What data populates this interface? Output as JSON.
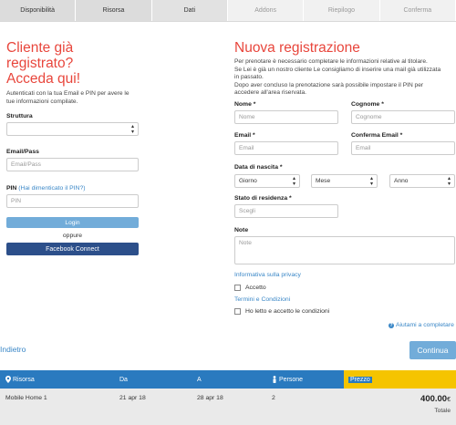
{
  "steps": [
    "Disponibilità",
    "Risorsa",
    "Dati",
    "Addons",
    "Riepilogo",
    "Conferma"
  ],
  "login": {
    "title_l1": "Cliente già",
    "title_l2": "registrato?",
    "title_l3": "Acceda qui!",
    "intro_l1": "Autenticati con la tua Email e PIN per avere le",
    "intro_l2": "tue informazioni compilate.",
    "structure_label": "Struttura",
    "structure_value": "",
    "email_label": "Email/Pass",
    "email_placeholder": "Email/Pass",
    "pin_label": "PIN",
    "pin_forgot": "(Hai dimenticato il PIN?)",
    "pin_placeholder": "PIN",
    "login_button": "Login",
    "or_text": "oppure",
    "facebook_button": "Facebook Connect"
  },
  "register": {
    "title": "Nuova registrazione",
    "info_l1": "Per prenotare è necessario completare le informazioni relative al titolare.",
    "info_l2": "Se Lei è già un nostro cliente Le consigliamo di inserire una mail già utilizzata",
    "info_l3": "in passato.",
    "info_l4": "Dopo aver concluso la prenotazione sarà possibile impostare il PIN per",
    "info_l5": "accedere all'area riservata.",
    "name_label": "Nome *",
    "name_placeholder": "Nome",
    "surname_label": "Cognome *",
    "surname_placeholder": "Cognome",
    "email_label": "Email *",
    "email_placeholder": "Email",
    "email_confirm_label": "Conferma Email *",
    "email_confirm_placeholder": "Email",
    "dob_label": "Data di nascita *",
    "day_value": "Giorno",
    "month_value": "Mese",
    "year_value": "Anno",
    "country_label": "Stato di residenza *",
    "country_placeholder": "Scegli",
    "note_label": "Note",
    "note_placeholder": "Note",
    "privacy_link": "Informativa sulla privacy",
    "privacy_accept": "Accetto",
    "terms_link": "Termini e Condizioni",
    "terms_accept": "Ho letto e accetto le condizioni",
    "help_link": "Aiutami a completare",
    "help_icon": "question-icon"
  },
  "nav": {
    "back": "Indietro",
    "continue": "Continua"
  },
  "summary": {
    "headers": {
      "resource": "Risorsa",
      "from": "Da",
      "to": "A",
      "persons": "Persone",
      "price": "Prezzo"
    },
    "row": {
      "resource": "Mobile Home 1",
      "from": "21 apr 18",
      "to": "28 apr 18",
      "persons": "2",
      "price": "400.00",
      "currency": "€",
      "total_label": "Totale"
    }
  },
  "colors": {
    "accent_red": "#e8463c",
    "link_blue": "#3a87c7",
    "header_blue": "#2a7abf",
    "price_yellow": "#f5c400",
    "facebook": "#2c4f8a"
  }
}
